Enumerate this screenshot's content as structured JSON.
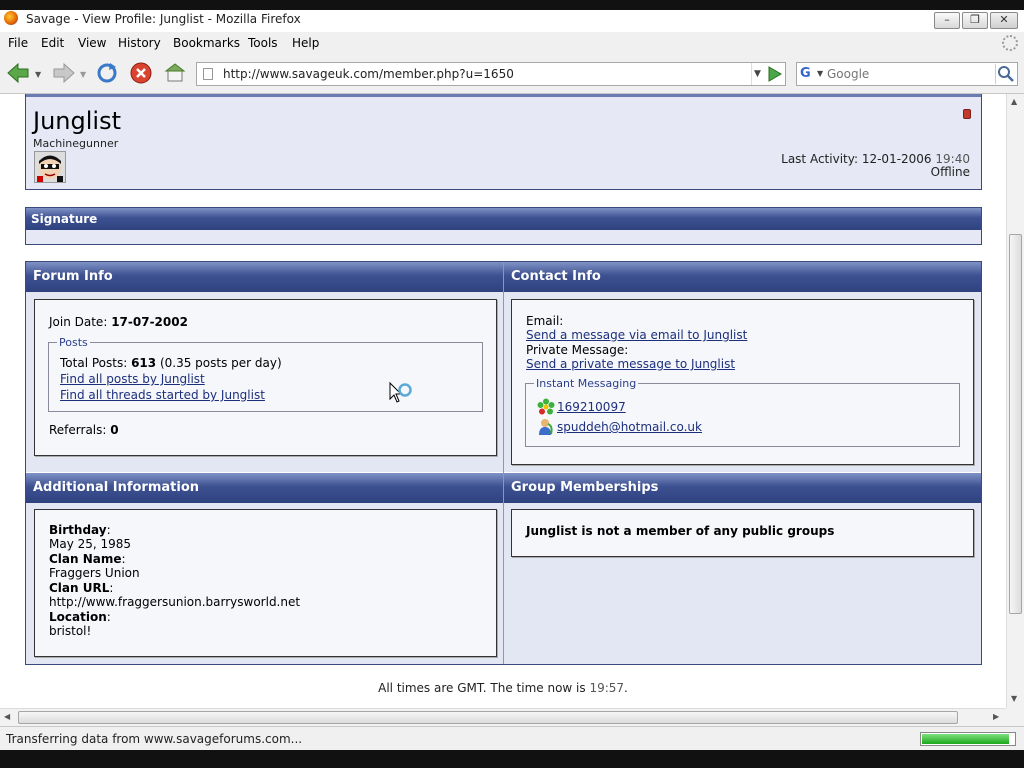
{
  "window": {
    "title": "Savage - View Profile: Junglist - Mozilla Firefox"
  },
  "menu": {
    "items": [
      "File",
      "Edit",
      "View",
      "History",
      "Bookmarks",
      "Tools",
      "Help"
    ]
  },
  "navbar": {
    "url": "http://www.savageuk.com/member.php?u=1650",
    "search_placeholder": "Google",
    "search_engine_icon": "google-icon"
  },
  "profile": {
    "username": "Junglist",
    "usertitle": "Machinegunner",
    "last_activity_label": "Last Activity:",
    "last_activity_date": "12-01-2006",
    "last_activity_time": "19:40",
    "online_status": "Offline",
    "status_color": "#c0392b"
  },
  "signature": {
    "heading": "Signature"
  },
  "forum_info": {
    "heading": "Forum Info",
    "join_date_label": "Join Date:",
    "join_date": "17-07-2002",
    "posts_legend": "Posts",
    "total_posts_label": "Total Posts:",
    "total_posts": "613",
    "posts_per_day": "(0.35 posts per day)",
    "find_posts_link": "Find all posts by Junglist",
    "find_threads_link": "Find all threads started by Junglist",
    "referrals_label": "Referrals:",
    "referrals": "0"
  },
  "contact_info": {
    "heading": "Contact Info",
    "email_label": "Email:",
    "email_link": "Send a message via email to Junglist",
    "pm_label": "Private Message:",
    "pm_link": "Send a private message to Junglist",
    "im_legend": "Instant Messaging",
    "icq_number": "169210097",
    "msn_address": "spuddeh@hotmail.co.uk"
  },
  "additional_info": {
    "heading": "Additional Information",
    "birthday_label": "Birthday",
    "birthday": "May 25, 1985",
    "clan_name_label": "Clan Name",
    "clan_name": "Fraggers Union",
    "clan_url_label": "Clan URL",
    "clan_url": "http://www.fraggersunion.barrysworld.net",
    "location_label": "Location",
    "location": "bristol!",
    "colon": ":"
  },
  "group_memberships": {
    "heading": "Group Memberships",
    "message": "Junglist is not a member of any public groups"
  },
  "footer": {
    "text_prefix": "All times are GMT. The time now is",
    "time": "19:57",
    "text_suffix": "."
  },
  "statusbar": {
    "text": "Transferring data from www.savageforums.com...",
    "progress_fraction": 0.95
  },
  "colors": {
    "header_dark": "#2b3e76",
    "header_light": "#6677aa",
    "panel_bg": "#e6e9f5",
    "link": "#1c2f7c"
  }
}
